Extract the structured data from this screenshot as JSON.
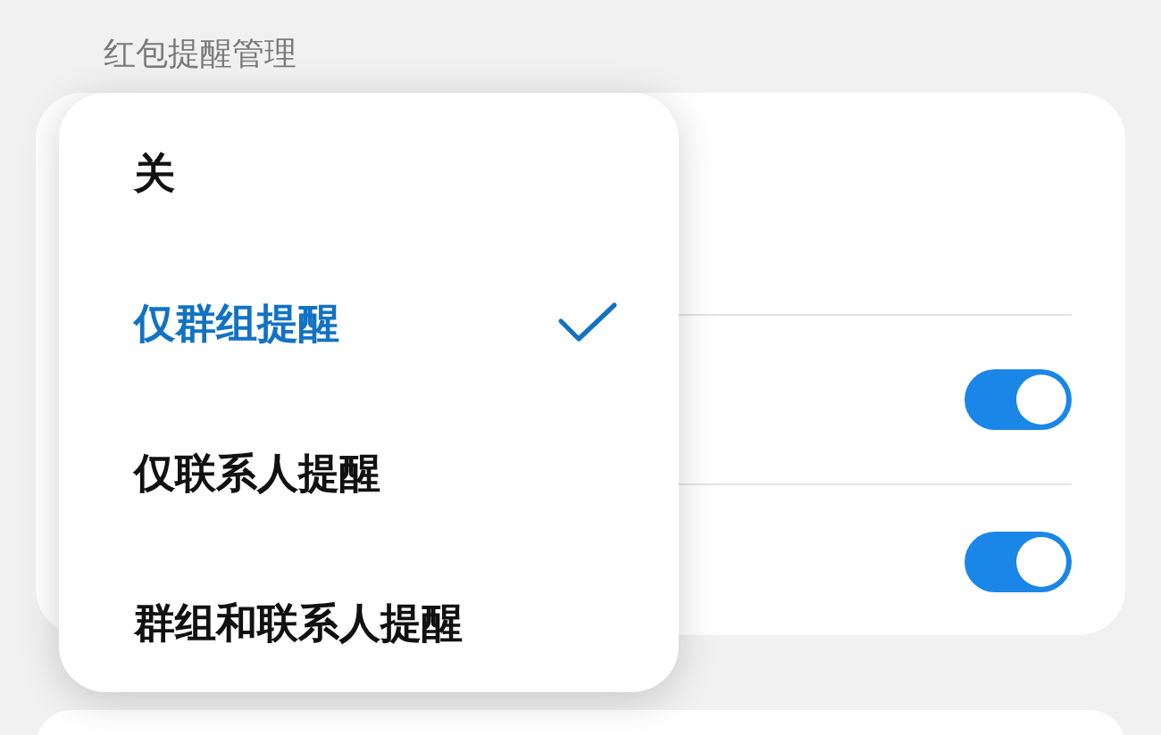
{
  "section_title": "红包提醒管理",
  "rows": [
    {
      "kind": "plain"
    },
    {
      "kind": "toggle",
      "on": true
    },
    {
      "kind": "toggle",
      "on": true
    }
  ],
  "menu": {
    "items": [
      {
        "label": "关",
        "selected": false
      },
      {
        "label": "仅群组提醒",
        "selected": true
      },
      {
        "label": "仅联系人提醒",
        "selected": false
      },
      {
        "label": "群组和联系人提醒",
        "selected": false
      }
    ]
  }
}
